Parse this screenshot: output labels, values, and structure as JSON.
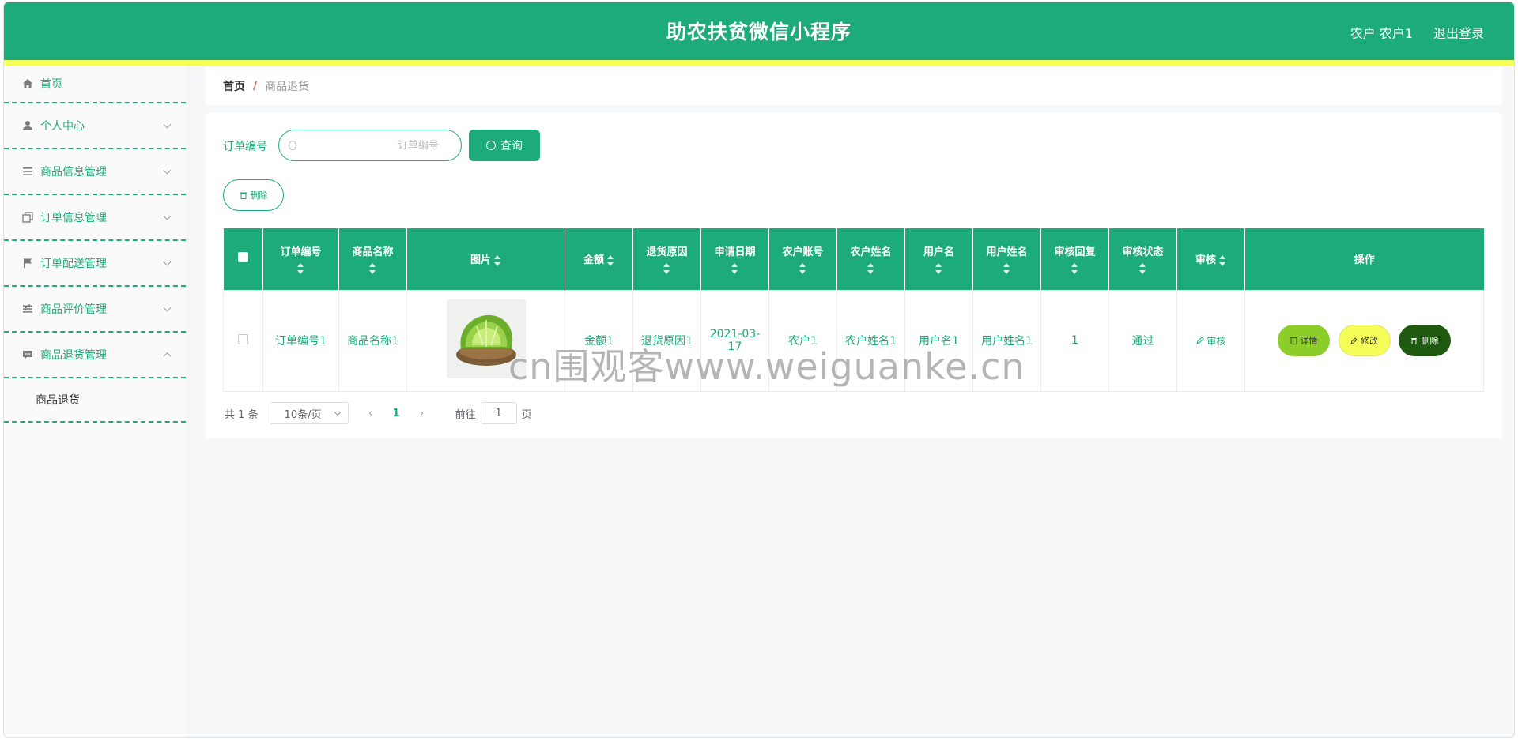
{
  "header": {
    "title": "助农扶贫微信小程序",
    "user": "农户 农户1",
    "logout": "退出登录"
  },
  "sidebar": {
    "items": [
      {
        "label": "首页",
        "icon": "home-icon"
      },
      {
        "label": "个人中心",
        "icon": "user-icon"
      },
      {
        "label": "商品信息管理",
        "icon": "list-icon"
      },
      {
        "label": "订单信息管理",
        "icon": "copy-icon"
      },
      {
        "label": "订单配送管理",
        "icon": "flag-icon"
      },
      {
        "label": "商品评价管理",
        "icon": "sliders-icon"
      },
      {
        "label": "商品退货管理",
        "icon": "message-icon"
      }
    ],
    "submenu": {
      "label": "商品退货"
    }
  },
  "breadcrumb": {
    "home": "首页",
    "separator": "/",
    "current": "商品退货"
  },
  "search": {
    "label": "订单编号",
    "placeholder": "订单编号",
    "button": "查询"
  },
  "toolbar": {
    "delete": "删除"
  },
  "table": {
    "columns": [
      "订单编号",
      "商品名称",
      "图片",
      "金额",
      "退货原因",
      "申请日期",
      "农户账号",
      "农户姓名",
      "用户名",
      "用户姓名",
      "审核回复",
      "审核状态",
      "审核",
      "操作"
    ],
    "rows": [
      {
        "order_no": "订单编号1",
        "product_name": "商品名称1",
        "amount": "金额1",
        "reason": "退货原因1",
        "date": "2021-03-17",
        "farmer_account": "农户1",
        "farmer_name": "农户姓名1",
        "username": "用户名1",
        "user_fullname": "用户姓名1",
        "audit_reply": "1",
        "audit_status": "通过",
        "audit_label": "审核",
        "actions": {
          "detail": "详情",
          "edit": "修改",
          "delete": "删除"
        }
      }
    ]
  },
  "pagination": {
    "total": "共 1 条",
    "page_size": "10条/页",
    "current_page": "1",
    "goto_prefix": "前往",
    "goto_value": "1",
    "goto_suffix": "页"
  },
  "watermark": "cn围观客www.weiguanke.cn",
  "colors": {
    "primary": "#1dab7a",
    "accent_yellow": "#f6ff5a",
    "detail": "#8ccd2a",
    "delete": "#1f5a10"
  }
}
